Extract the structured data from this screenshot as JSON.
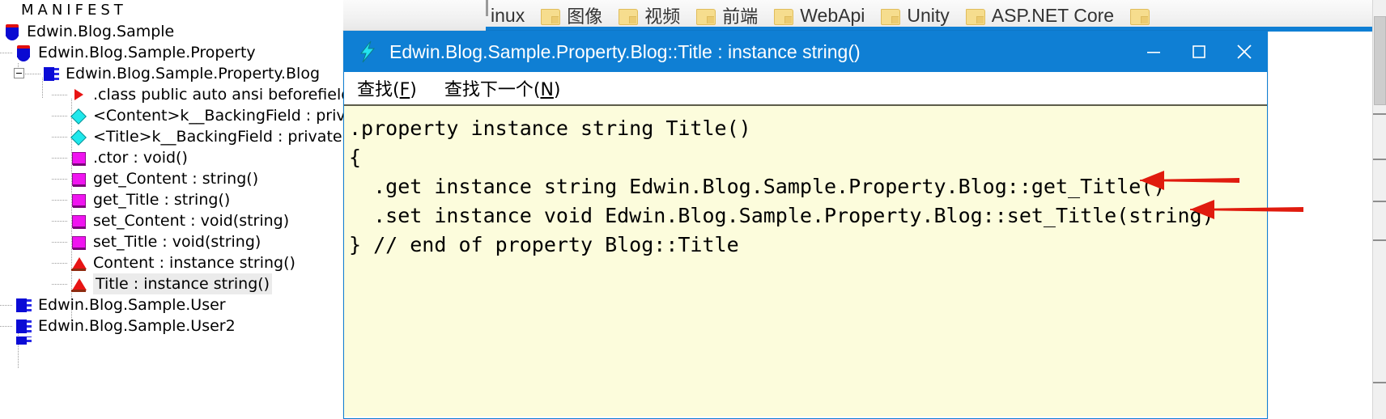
{
  "browser": {
    "bookmarks": [
      {
        "label": "inux",
        "icon": "none",
        "partial": true
      },
      {
        "label": "图像",
        "icon": "folder-icon"
      },
      {
        "label": "视频",
        "icon": "folder-icon"
      },
      {
        "label": "前端",
        "icon": "folder-icon"
      },
      {
        "label": "WebApi",
        "icon": "folder-icon"
      },
      {
        "label": "Unity",
        "icon": "folder-icon"
      },
      {
        "label": "ASP.NET Core",
        "icon": "folder-icon"
      },
      {
        "label": "",
        "icon": "folder-icon",
        "partial": true
      }
    ],
    "scrollbar": {
      "name": "page-scrollbar"
    }
  },
  "tree": {
    "name": "ildasm-tree",
    "items": [
      {
        "label": "MANIFEST",
        "icon": "manifest-icon",
        "indent": 0,
        "selected": false,
        "style": "manifest"
      },
      {
        "label": "Edwin.Blog.Sample",
        "icon": "assembly-icon",
        "indent": 0,
        "selected": false
      },
      {
        "label": "Edwin.Blog.Sample.Property",
        "icon": "assembly-icon",
        "indent": 1,
        "selected": false
      },
      {
        "label": "Edwin.Blog.Sample.Property.Blog",
        "icon": "class-icon",
        "indent": 2,
        "selected": false,
        "expanded": true
      },
      {
        "label": ".class public auto ansi beforefieldinit",
        "icon": "class-info-icon",
        "indent": 3,
        "selected": false
      },
      {
        "label": "<Content>k__BackingField : private string",
        "icon": "field-icon",
        "indent": 3,
        "selected": false
      },
      {
        "label": "<Title>k__BackingField : private string",
        "icon": "field-icon",
        "indent": 3,
        "selected": false
      },
      {
        "label": ".ctor : void()",
        "icon": "method-icon",
        "indent": 3,
        "selected": false
      },
      {
        "label": "get_Content : string()",
        "icon": "method-icon",
        "indent": 3,
        "selected": false
      },
      {
        "label": "get_Title : string()",
        "icon": "method-icon",
        "indent": 3,
        "selected": false
      },
      {
        "label": "set_Content : void(string)",
        "icon": "method-icon",
        "indent": 3,
        "selected": false
      },
      {
        "label": "set_Title : void(string)",
        "icon": "method-icon",
        "indent": 3,
        "selected": false
      },
      {
        "label": "Content : instance string()",
        "icon": "property-icon",
        "indent": 3,
        "selected": false
      },
      {
        "label": "Title : instance string()",
        "icon": "property-icon",
        "indent": 3,
        "selected": true
      },
      {
        "label": "Edwin.Blog.Sample.User",
        "icon": "class-icon",
        "indent": 0,
        "selected": false
      },
      {
        "label": "Edwin.Blog.Sample.User2",
        "icon": "class-icon",
        "indent": 0,
        "selected": false
      }
    ]
  },
  "ildasm_window": {
    "app_icon": "lightning-bolt-icon",
    "title": "Edwin.Blog.Sample.Property.Blog::Title : instance string()",
    "controls": {
      "minimize": {
        "name": "minimize-button",
        "glyph": "─"
      },
      "maximize": {
        "name": "maximize-button",
        "glyph": "☐"
      },
      "close": {
        "name": "close-button",
        "glyph": "✕"
      }
    },
    "menu": [
      {
        "name": "menu-find",
        "pre": "查找(",
        "accel": "F",
        "post": ")"
      },
      {
        "name": "menu-find-next",
        "pre": "查找下一个(",
        "accel": "N",
        "post": ")"
      }
    ],
    "code_lines": [
      ".property instance string Title()",
      "{",
      "  .get instance string Edwin.Blog.Sample.Property.Blog::get_Title()",
      "  .set instance void Edwin.Blog.Sample.Property.Blog::set_Title(string)",
      "} // end of property Blog::Title"
    ],
    "background_color": "#fcfcdc",
    "titlebar_color": "#0f7fd4"
  },
  "annotations": {
    "color": "#e01b0e",
    "arrows": [
      {
        "name": "get-accessor-arrow",
        "target_line_index": 2
      },
      {
        "name": "set-accessor-arrow",
        "target_line_index": 3
      }
    ]
  }
}
